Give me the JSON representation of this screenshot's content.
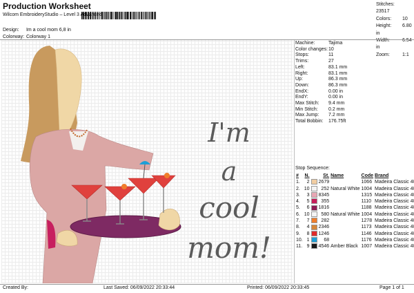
{
  "header": {
    "title": "Production Worksheet",
    "subtitle": "Wilcom EmbroideryStudio – Level 3 Advanced",
    "design_label": "Design:",
    "design_value": "Im a cool mom 6,8 in",
    "colorway_label": "Colorway:",
    "colorway_value": "Colorway 1"
  },
  "summary": [
    {
      "label": "Stitches:",
      "value": "23517"
    },
    {
      "label": "Colors:",
      "value": "10"
    },
    {
      "label": "Height:",
      "value": "6.80 in"
    },
    {
      "label": "Width:",
      "value": "6.54 in"
    },
    {
      "label": "Zoom:",
      "value": "1:1"
    }
  ],
  "machine_info": [
    {
      "label": "Machine:",
      "value": "Tajima"
    },
    {
      "label": "Color changes:",
      "value": "10"
    },
    {
      "label": "Stops:",
      "value": "11"
    },
    {
      "label": "Trims:",
      "value": "27"
    },
    {
      "label": "Left:",
      "value": "83.1 mm"
    },
    {
      "label": "Right:",
      "value": "83.1 mm"
    },
    {
      "label": "Up:",
      "value": "86.3 mm"
    },
    {
      "label": "Down:",
      "value": "86.3 mm"
    },
    {
      "label": "EndX:",
      "value": "0.00 in"
    },
    {
      "label": "EndY:",
      "value": "0.00 in"
    },
    {
      "label": "Max Stitch:",
      "value": "9.4 mm"
    },
    {
      "label": "Min Stitch:",
      "value": "0.2 mm"
    },
    {
      "label": "Max Jump:",
      "value": "7.2 mm"
    },
    {
      "label": "Total Bobbin:",
      "value": "176.75ft"
    }
  ],
  "stop_sequence": {
    "heading": "Stop Sequence:",
    "columns": [
      "#",
      "N.",
      "",
      "St.",
      "Name",
      "Code",
      "Brand"
    ],
    "rows": [
      {
        "idx": "1.",
        "n": "2",
        "color": "#f1cda2",
        "st": "2679",
        "name": "",
        "code": "1066",
        "brand": "Madeira Classic 40"
      },
      {
        "idx": "2.",
        "n": "10",
        "color": "#f4f4f4",
        "st": "252",
        "name": "Natural White",
        "code": "1004",
        "brand": "Madeira Classic 40"
      },
      {
        "idx": "3.",
        "n": "3",
        "color": "#e8a7b4",
        "st": "8345",
        "name": "",
        "code": "1315",
        "brand": "Madeira Classic 40"
      },
      {
        "idx": "4.",
        "n": "5",
        "color": "#c81e5a",
        "st": "355",
        "name": "",
        "code": "1110",
        "brand": "Madeira Classic 40"
      },
      {
        "idx": "5.",
        "n": "6",
        "color": "#8e1d55",
        "st": "1816",
        "name": "",
        "code": "1188",
        "brand": "Madeira Classic 40"
      },
      {
        "idx": "6.",
        "n": "10",
        "color": "#f4f4f4",
        "st": "580",
        "name": "Natural White",
        "code": "1004",
        "brand": "Madeira Classic 40"
      },
      {
        "idx": "7.",
        "n": "7",
        "color": "#f07d2c",
        "st": "282",
        "name": "",
        "code": "1278",
        "brand": "Madeira Classic 40"
      },
      {
        "idx": "8.",
        "n": "4",
        "color": "#d6873a",
        "st": "2346",
        "name": "",
        "code": "1173",
        "brand": "Madeira Classic 40"
      },
      {
        "idx": "9.",
        "n": "8",
        "color": "#e02a2a",
        "st": "1246",
        "name": "",
        "code": "1146",
        "brand": "Madeira Classic 40"
      },
      {
        "idx": "10.",
        "n": "1",
        "color": "#1e9fd6",
        "st": "68",
        "name": "",
        "code": "1176",
        "brand": "Madeira Classic 40"
      },
      {
        "idx": "11.",
        "n": "9",
        "color": "#1a1a1a",
        "st": "4546",
        "name": "Amber Black",
        "code": "1007",
        "brand": "Madeira Classic 40"
      }
    ]
  },
  "design_text": {
    "line1": "I'm",
    "line2": "a",
    "line3": "cool",
    "line4": "mom!"
  },
  "footer": {
    "created": "Created By:",
    "last_saved": "Last Saved: 06/09/2022 20:33:44",
    "printed": "Printed: 06/09/2022 20:33:45",
    "page": "Page 1 of 1"
  }
}
